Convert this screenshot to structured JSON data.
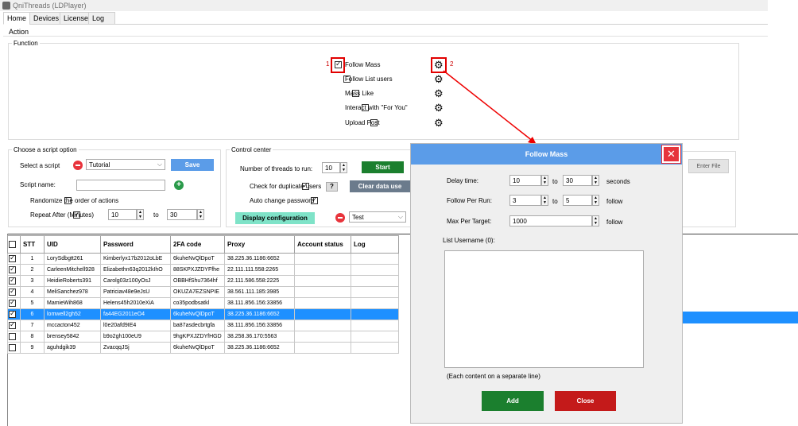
{
  "window": {
    "title": "QniThreads (LDPlayer)"
  },
  "tabs": [
    "Home",
    "Devices",
    "License",
    "Log"
  ],
  "action_label": "Action",
  "function": {
    "legend": "Function",
    "items": [
      {
        "label": "Follow Mass",
        "checked": true
      },
      {
        "label": "Follow List users",
        "checked": false
      },
      {
        "label": "Mass Like",
        "checked": false
      },
      {
        "label": "Interact with \"For You\"",
        "checked": false
      },
      {
        "label": "Upload Post",
        "checked": false
      }
    ],
    "marker1": "1",
    "marker2": "2"
  },
  "script": {
    "legend": "Choose a script option",
    "select_label": "Select a script",
    "selected": "Tutorial",
    "save": "Save",
    "name_label": "Script name:",
    "name_value": "",
    "randomize": "Randomize the order of actions",
    "repeat": "Repeat After (Minutes)",
    "repeat_from": "10",
    "to": "to",
    "repeat_to": "30"
  },
  "control": {
    "legend": "Control center",
    "threads_label": "Number of threads to run:",
    "threads": "10",
    "start": "Start",
    "dup": "Check for duplicate users",
    "dup_help": "?",
    "clear": "Clear data use",
    "auto_pw": "Auto change password",
    "display": "Display configuration",
    "config": "Test",
    "enter_file": "Enter File"
  },
  "table": {
    "headers": [
      "STT",
      "UID",
      "Password",
      "2FA code",
      "Proxy",
      "Account status",
      "Log"
    ],
    "rows": [
      {
        "checked": true,
        "stt": "1",
        "uid": "LorySdbgtt261",
        "password": "Kimberlyx17b2012oLbE",
        "fa": "6kuheNvQlDpoT",
        "proxy": "38.225.36.1186:6652",
        "status": "",
        "log": "",
        "selected": false
      },
      {
        "checked": true,
        "stt": "2",
        "uid": "CarleenMitchell928",
        "password": "Elizabethn63q2012kIhO",
        "fa": "88SKPXJZDYFfhe",
        "proxy": "22.111.111.558:2265",
        "status": "",
        "log": "",
        "selected": false
      },
      {
        "checked": true,
        "stt": "3",
        "uid": "HeidieRoberts391",
        "password": "Carolg03z100yOsJ",
        "fa": "OBBHfShu7364hf",
        "proxy": "22.111.586.558:2225",
        "status": "",
        "log": "",
        "selected": false
      },
      {
        "checked": true,
        "stt": "4",
        "uid": "MeliSanchez978",
        "password": "Patriciav48e9eJsU",
        "fa": "OKUZA7EZSNPIE",
        "proxy": "38.561.111.185:3985",
        "status": "",
        "log": "",
        "selected": false
      },
      {
        "checked": true,
        "stt": "5",
        "uid": "MamieWih868",
        "password": "Helens45h2010eXiA",
        "fa": "co35podbsatkl",
        "proxy": "38.111.856.156:33856",
        "status": "",
        "log": "",
        "selected": false
      },
      {
        "checked": true,
        "stt": "6",
        "uid": "lomwell2gh52",
        "password": "fa44EG2011eO4",
        "fa": "6kuheNvQlDpoT",
        "proxy": "38.225.36.1186:6652",
        "status": "",
        "log": "",
        "selected": true
      },
      {
        "checked": true,
        "stt": "7",
        "uid": "mccacton452",
        "password": "l0e20afd9IE4",
        "fa": "ba87asdecbrtgfa",
        "proxy": "38.111.856.156:33856",
        "status": "",
        "log": "",
        "selected": false
      },
      {
        "checked": false,
        "stt": "8",
        "uid": "brensey5842",
        "password": "b9o2gh100eU9",
        "fa": "9hgKPXJZDYfHGD",
        "proxy": "38.258.36.170:5563",
        "status": "",
        "log": "",
        "selected": false
      },
      {
        "checked": false,
        "stt": "9",
        "uid": "aguhdgik39",
        "password": "ZvacqqJSj",
        "fa": "6kuheNvQlDpoT",
        "proxy": "38.225.36.1186:6652",
        "status": "",
        "log": "",
        "selected": false
      }
    ]
  },
  "dialog": {
    "title": "Follow Mass",
    "close_x": "✕",
    "delay_label": "Delay time:",
    "delay_from": "10",
    "delay_to": "30",
    "delay_unit": "seconds",
    "per_run_label": "Follow Per Run:",
    "per_run_from": "3",
    "per_run_to": "5",
    "per_run_unit": "follow",
    "max_label": "Max Per Target:",
    "max_value": "1000",
    "max_unit": "follow",
    "to": "to",
    "list_label": "List Username (0):",
    "hint": "(Each content on a separate line)",
    "add": "Add",
    "close": "Close"
  },
  "colors": {
    "accent": "#5b9ce8",
    "start": "#1b7f2e",
    "close": "#c41a1a",
    "select": "#1e90ff",
    "display": "#7fe3c8"
  }
}
